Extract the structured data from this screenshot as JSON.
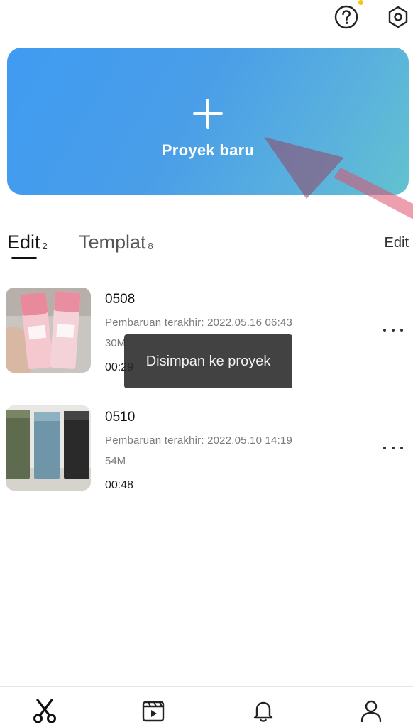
{
  "header": {
    "help_icon": "help-circle-icon",
    "settings_icon": "hexagon-gear-icon",
    "notification_dot_color": "#f5c518"
  },
  "new_project": {
    "label": "Proyek baru",
    "icon": "plus-icon",
    "gradient": [
      "#3f9bf2",
      "#62c2cf"
    ]
  },
  "tabs": [
    {
      "label": "Edit",
      "count": "2"
    },
    {
      "label": "Templat",
      "count": "8"
    }
  ],
  "edit_link": "Edit",
  "projects": [
    {
      "title": "0508",
      "updated": "Pembaruan terakhir: 2022.05.16 06:43",
      "size": "30M",
      "duration": "00:29"
    },
    {
      "title": "0510",
      "updated": "Pembaruan terakhir: 2022.05.10 14:19",
      "size": "54M",
      "duration": "00:48"
    }
  ],
  "toast": {
    "text": "Disimpan ke proyek"
  },
  "bottom_nav": [
    {
      "icon": "scissors-icon"
    },
    {
      "icon": "film-clapper-icon"
    },
    {
      "icon": "bell-icon"
    },
    {
      "icon": "profile-icon"
    }
  ]
}
